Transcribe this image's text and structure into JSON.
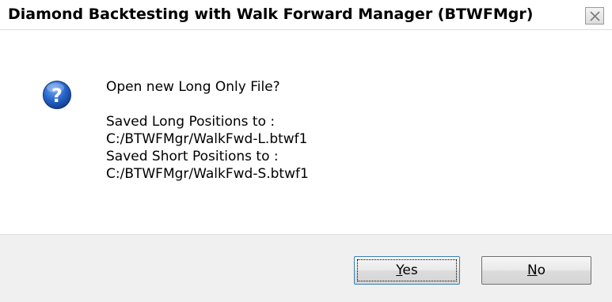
{
  "window": {
    "title": "Diamond Backtesting with Walk Forward Manager (BTWFMgr)"
  },
  "dialog": {
    "icon": "question-icon",
    "question": "Open new Long Only File?",
    "lines": [
      "Saved Long Positions to :",
      "C:/BTWFMgr/WalkFwd-L.btwf1",
      "Saved Short Positions to :",
      "C:/BTWFMgr/WalkFwd-S.btwf1"
    ]
  },
  "buttons": {
    "yes": {
      "accel": "Y",
      "rest": "es"
    },
    "no": {
      "accel": "N",
      "rest": "o"
    }
  },
  "colors": {
    "icon_blue": "#1d58b8",
    "footer_bg": "#f0f0f0"
  }
}
